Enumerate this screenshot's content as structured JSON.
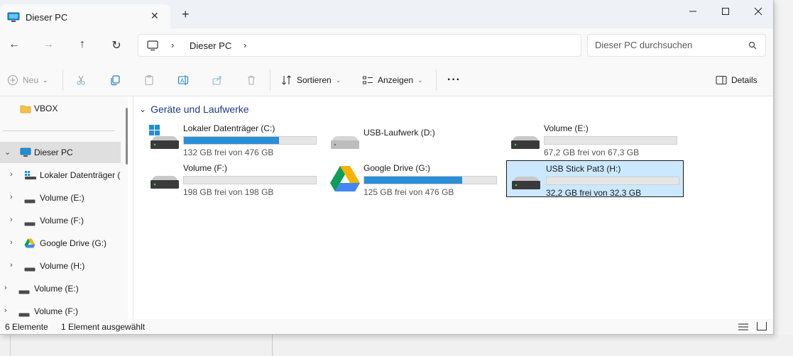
{
  "tab": {
    "title": "Dieser PC",
    "icon": "computer-icon"
  },
  "window_controls": {
    "minimize": "minimize-icon",
    "maximize": "maximize-icon",
    "close": "close-icon"
  },
  "address": {
    "crumb": "Dieser PC"
  },
  "search": {
    "placeholder": "Dieser PC durchsuchen"
  },
  "commands": {
    "new_label": "Neu",
    "sort_label": "Sortieren",
    "view_label": "Anzeigen",
    "more_label": "···",
    "details_label": "Details"
  },
  "sidebar": {
    "items": [
      {
        "label": "VBOX"
      },
      {
        "label": "Dieser PC"
      },
      {
        "label": "Lokaler Datenträger (C"
      },
      {
        "label": "Volume (E:)"
      },
      {
        "label": "Volume (F:)"
      },
      {
        "label": "Google Drive (G:)"
      },
      {
        "label": "Volume (H:)"
      },
      {
        "label": "Volume (E:)"
      },
      {
        "label": "Volume (F:)"
      }
    ]
  },
  "content": {
    "group_title": "Geräte und Laufwerke",
    "drives": [
      {
        "name": "Lokaler Datenträger (C:)",
        "free": "132 GB frei von 476 GB",
        "used_fraction": 0.72,
        "icon": "windows-drive-icon"
      },
      {
        "name": "USB-Laufwerk (D:)",
        "free": "",
        "used_fraction": null,
        "icon": "drive-icon"
      },
      {
        "name": "Volume (E:)",
        "free": "67,2 GB frei von 67,3 GB",
        "used_fraction": 0.0,
        "icon": "drive-icon"
      },
      {
        "name": "Volume (F:)",
        "free": "198 GB frei von 198 GB",
        "used_fraction": 0.0,
        "icon": "drive-icon"
      },
      {
        "name": "Google Drive (G:)",
        "free": "125 GB frei von 476 GB",
        "used_fraction": 0.74,
        "icon": "google-drive-icon"
      },
      {
        "name": "USB Stick Pat3  (H:)",
        "free": "32,2 GB frei von 32,3 GB",
        "used_fraction": 0.0,
        "icon": "drive-icon"
      }
    ]
  },
  "status": {
    "count": "6 Elemente",
    "selection": "1 Element ausgewählt"
  },
  "colors": {
    "accent": "#2a8fd6",
    "selection": "#cce8ff",
    "group_title": "#1b3a8a"
  }
}
